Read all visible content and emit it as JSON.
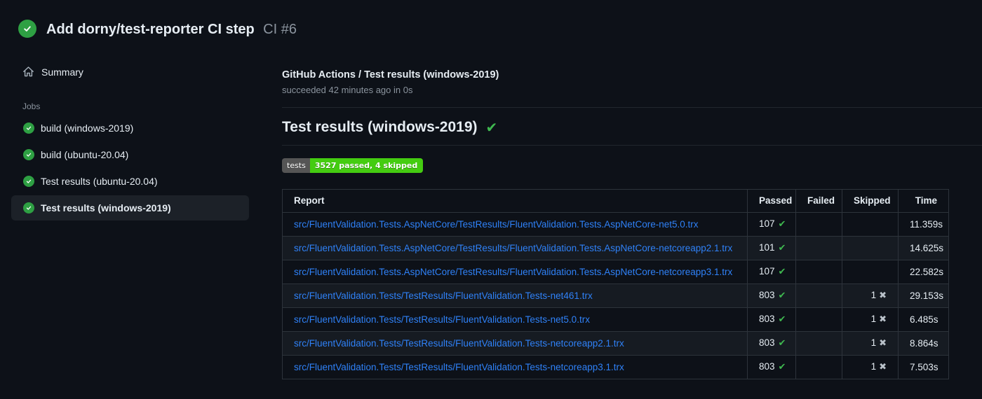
{
  "header": {
    "title": "Add dorny/test-reporter CI step",
    "run_number": "CI #6",
    "status_icon": "check-circle-icon"
  },
  "sidebar": {
    "summary_label": "Summary",
    "jobs_section_label": "Jobs",
    "jobs": [
      {
        "label": "build (windows-2019)",
        "selected": false
      },
      {
        "label": "build (ubuntu-20.04)",
        "selected": false
      },
      {
        "label": "Test results (ubuntu-20.04)",
        "selected": false
      },
      {
        "label": "Test results (windows-2019)",
        "selected": true
      }
    ]
  },
  "main": {
    "check_title": "GitHub Actions / Test results (windows-2019)",
    "check_status": "succeeded 42 minutes ago in 0s",
    "section_title": "Test results (windows-2019)",
    "section_status_icon": "check-icon",
    "badge": {
      "label": "tests",
      "value": "3527 passed, 4 skipped",
      "label_bg": "#555555",
      "value_bg": "#44cc11"
    },
    "table": {
      "columns": [
        "Report",
        "Passed",
        "Failed",
        "Skipped",
        "Time"
      ],
      "pass_icon": "✔",
      "skip_icon": "✖",
      "rows": [
        {
          "report": "src/FluentValidation.Tests.AspNetCore/TestResults/FluentValidation.Tests.AspNetCore-net5.0.trx",
          "passed": "107",
          "failed": "",
          "skipped": "",
          "time": "11.359s"
        },
        {
          "report": "src/FluentValidation.Tests.AspNetCore/TestResults/FluentValidation.Tests.AspNetCore-netcoreapp2.1.trx",
          "passed": "101",
          "failed": "",
          "skipped": "",
          "time": "14.625s"
        },
        {
          "report": "src/FluentValidation.Tests.AspNetCore/TestResults/FluentValidation.Tests.AspNetCore-netcoreapp3.1.trx",
          "passed": "107",
          "failed": "",
          "skipped": "",
          "time": "22.582s"
        },
        {
          "report": "src/FluentValidation.Tests/TestResults/FluentValidation.Tests-net461.trx",
          "passed": "803",
          "failed": "",
          "skipped": "1",
          "time": "29.153s"
        },
        {
          "report": "src/FluentValidation.Tests/TestResults/FluentValidation.Tests-net5.0.trx",
          "passed": "803",
          "failed": "",
          "skipped": "1",
          "time": "6.485s"
        },
        {
          "report": "src/FluentValidation.Tests/TestResults/FluentValidation.Tests-netcoreapp2.1.trx",
          "passed": "803",
          "failed": "",
          "skipped": "1",
          "time": "8.864s"
        },
        {
          "report": "src/FluentValidation.Tests/TestResults/FluentValidation.Tests-netcoreapp3.1.trx",
          "passed": "803",
          "failed": "",
          "skipped": "1",
          "time": "7.503s"
        }
      ]
    }
  },
  "colors": {
    "page_bg": "#0d1118",
    "success_green": "#2ea043",
    "check_green": "#3fb950",
    "link_blue": "#2f81f7",
    "muted_text": "#8b949e",
    "table_border": "#2d333b",
    "row_alt_bg": "#161b22",
    "selected_item_bg": "#1c2128"
  }
}
